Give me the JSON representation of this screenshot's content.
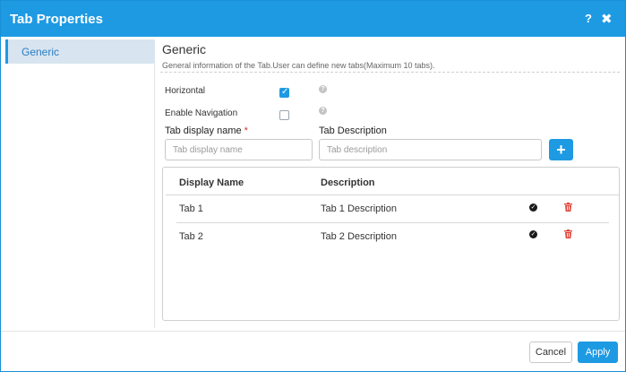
{
  "dialog": {
    "title": "Tab Properties",
    "help_glyph": "?",
    "close_glyph": "✖"
  },
  "sidebar": {
    "items": [
      {
        "label": "Generic",
        "active": true
      }
    ]
  },
  "section": {
    "title": "Generic",
    "description": "General information of the Tab.User can define new tabs(Maximum 10 tabs)."
  },
  "options": {
    "horizontal": {
      "label": "Horizontal",
      "checked": true
    },
    "enable_navigation": {
      "label": "Enable Navigation",
      "checked": false
    },
    "help_glyph": "?"
  },
  "form": {
    "tab_display_name": {
      "label": "Tab display name",
      "required_mark": "*",
      "placeholder": "Tab display name",
      "value": ""
    },
    "tab_description": {
      "label": "Tab Description",
      "placeholder": "Tab description",
      "value": ""
    },
    "add_glyph": "+"
  },
  "table": {
    "columns": [
      "Display Name",
      "Description"
    ],
    "rows": [
      {
        "display_name": "Tab 1",
        "description": "Tab 1 Description"
      },
      {
        "display_name": "Tab 2",
        "description": "Tab 2 Description"
      }
    ],
    "row_icons": [
      "check-icon",
      "trash-icon"
    ]
  },
  "footer": {
    "cancel_label": "Cancel",
    "apply_label": "Apply"
  },
  "colors": {
    "accent": "#1e9ae3",
    "delete": "#e0453a",
    "sidebar_active_bg": "#d8e4f0"
  }
}
